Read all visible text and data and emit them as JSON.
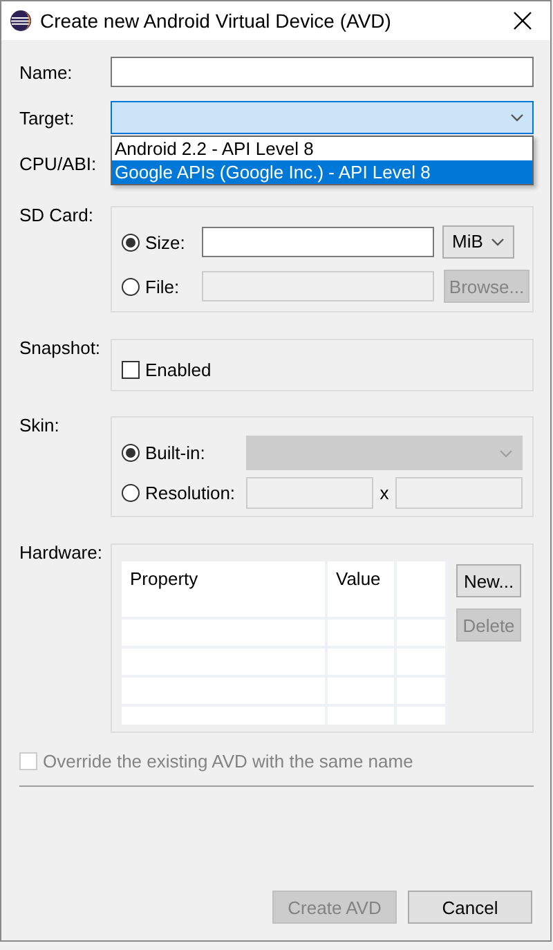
{
  "window": {
    "title": "Create new Android Virtual Device (AVD)"
  },
  "name": {
    "label": "Name:"
  },
  "target": {
    "label": "Target:",
    "options": [
      {
        "label": "Android 2.2 - API Level 8",
        "selected": false
      },
      {
        "label": "Google APIs (Google Inc.) - API Level 8",
        "selected": true
      }
    ]
  },
  "cpu_abi": {
    "label": "CPU/ABI:"
  },
  "sd_card": {
    "label": "SD Card:",
    "size": {
      "label": "Size:",
      "selected": true,
      "unit": "MiB"
    },
    "file": {
      "label": "File:",
      "selected": false,
      "field_disabled": true,
      "browse": {
        "label": "Browse...",
        "disabled": true
      }
    }
  },
  "snapshot": {
    "label": "Snapshot:",
    "enabled": {
      "label": "Enabled",
      "checked": false
    }
  },
  "skin": {
    "label": "Skin:",
    "built_in": {
      "label": "Built-in:",
      "selected": true,
      "combo_disabled": true
    },
    "resolution": {
      "label": "Resolution:",
      "selected": false,
      "fields_disabled": true,
      "separator": "x"
    }
  },
  "hardware": {
    "label": "Hardware:",
    "columns": [
      "Property",
      "Value"
    ],
    "buttons": [
      {
        "label": "New...",
        "disabled": false
      },
      {
        "label": "Delete",
        "disabled": true
      }
    ]
  },
  "override": {
    "label": "Override the existing AVD with the same name",
    "checked": false,
    "disabled": true
  },
  "buttons": [
    {
      "label": "Create AVD",
      "disabled": true
    },
    {
      "label": "Cancel",
      "disabled": false
    }
  ]
}
